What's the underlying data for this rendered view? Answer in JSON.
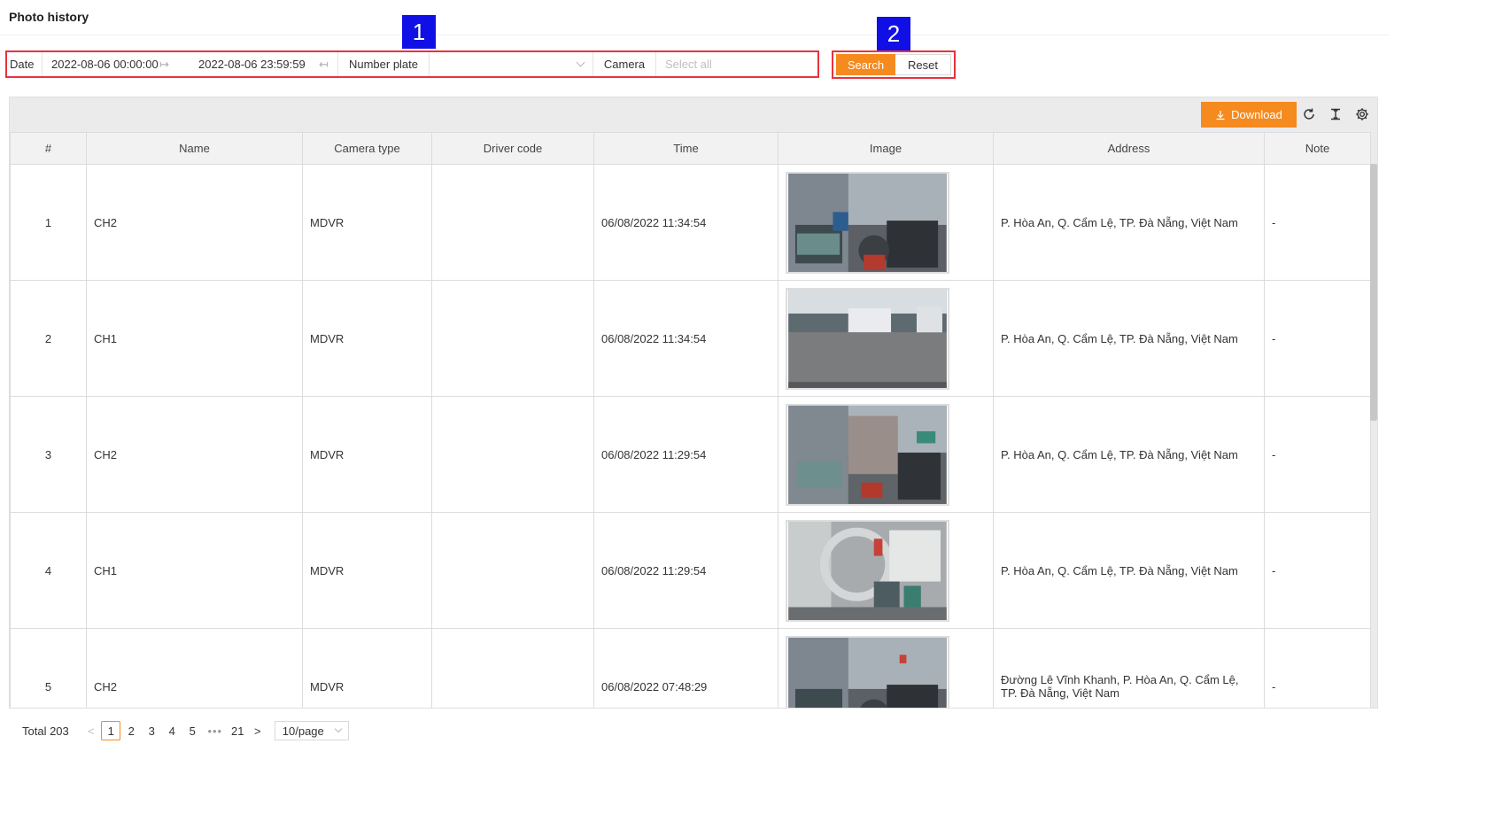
{
  "page": {
    "title": "Photo history"
  },
  "filters": {
    "date_label": "Date",
    "date_start": "2022-08-06 00:00:00",
    "date_end": "2022-08-06 23:59:59",
    "plate_label": "Number plate",
    "plate_value": "",
    "camera_label": "Camera",
    "camera_placeholder": "Select all"
  },
  "actions": {
    "search_label": "Search",
    "reset_label": "Reset"
  },
  "callouts": {
    "first": "1",
    "second": "2"
  },
  "toolbar": {
    "download_label": "Download"
  },
  "table": {
    "columns": [
      "#",
      "Name",
      "Camera type",
      "Driver code",
      "Time",
      "Image",
      "Address",
      "Note"
    ],
    "rows": [
      {
        "num": "1",
        "name": "CH2",
        "camera_type": "MDVR",
        "driver_code": "",
        "time": "06/08/2022 11:34:54",
        "image": "cab-interior",
        "address": "P. Hòa An, Q. Cẩm Lệ, TP. Đà Nẵng, Việt Nam",
        "note": "-"
      },
      {
        "num": "2",
        "name": "CH1",
        "camera_type": "MDVR",
        "driver_code": "",
        "time": "06/08/2022 11:34:54",
        "image": "yard-front-view",
        "address": "P. Hòa An, Q. Cẩm Lệ, TP. Đà Nẵng, Việt Nam",
        "note": "-"
      },
      {
        "num": "3",
        "name": "CH2",
        "camera_type": "MDVR",
        "driver_code": "",
        "time": "06/08/2022 11:29:54",
        "image": "cab-interior-blurred",
        "address": "P. Hòa An, Q. Cẩm Lệ, TP. Đà Nẵng, Việt Nam",
        "note": "-"
      },
      {
        "num": "4",
        "name": "CH1",
        "camera_type": "MDVR",
        "driver_code": "",
        "time": "06/08/2022 11:29:54",
        "image": "warehouse-stairs",
        "address": "P. Hòa An, Q. Cẩm Lệ, TP. Đà Nẵng, Việt Nam",
        "note": "-"
      },
      {
        "num": "5",
        "name": "CH2",
        "camera_type": "MDVR",
        "driver_code": "",
        "time": "06/08/2022 07:48:29",
        "image": "cab-interior",
        "address": "Đường Lê Vĩnh Khanh, P. Hòa An, Q. Cẩm Lệ, TP. Đà Nẵng, Việt Nam",
        "note": "-"
      }
    ]
  },
  "pagination": {
    "total_text": "Total 203",
    "pages": [
      "1",
      "2",
      "3",
      "4",
      "5"
    ],
    "ellipsis": "•••",
    "last_page": "21",
    "current": "1",
    "page_size": "10/page"
  },
  "colors": {
    "accent": "#f58a1f",
    "highlight_border": "#e8323c",
    "callout": "#1010e6"
  }
}
